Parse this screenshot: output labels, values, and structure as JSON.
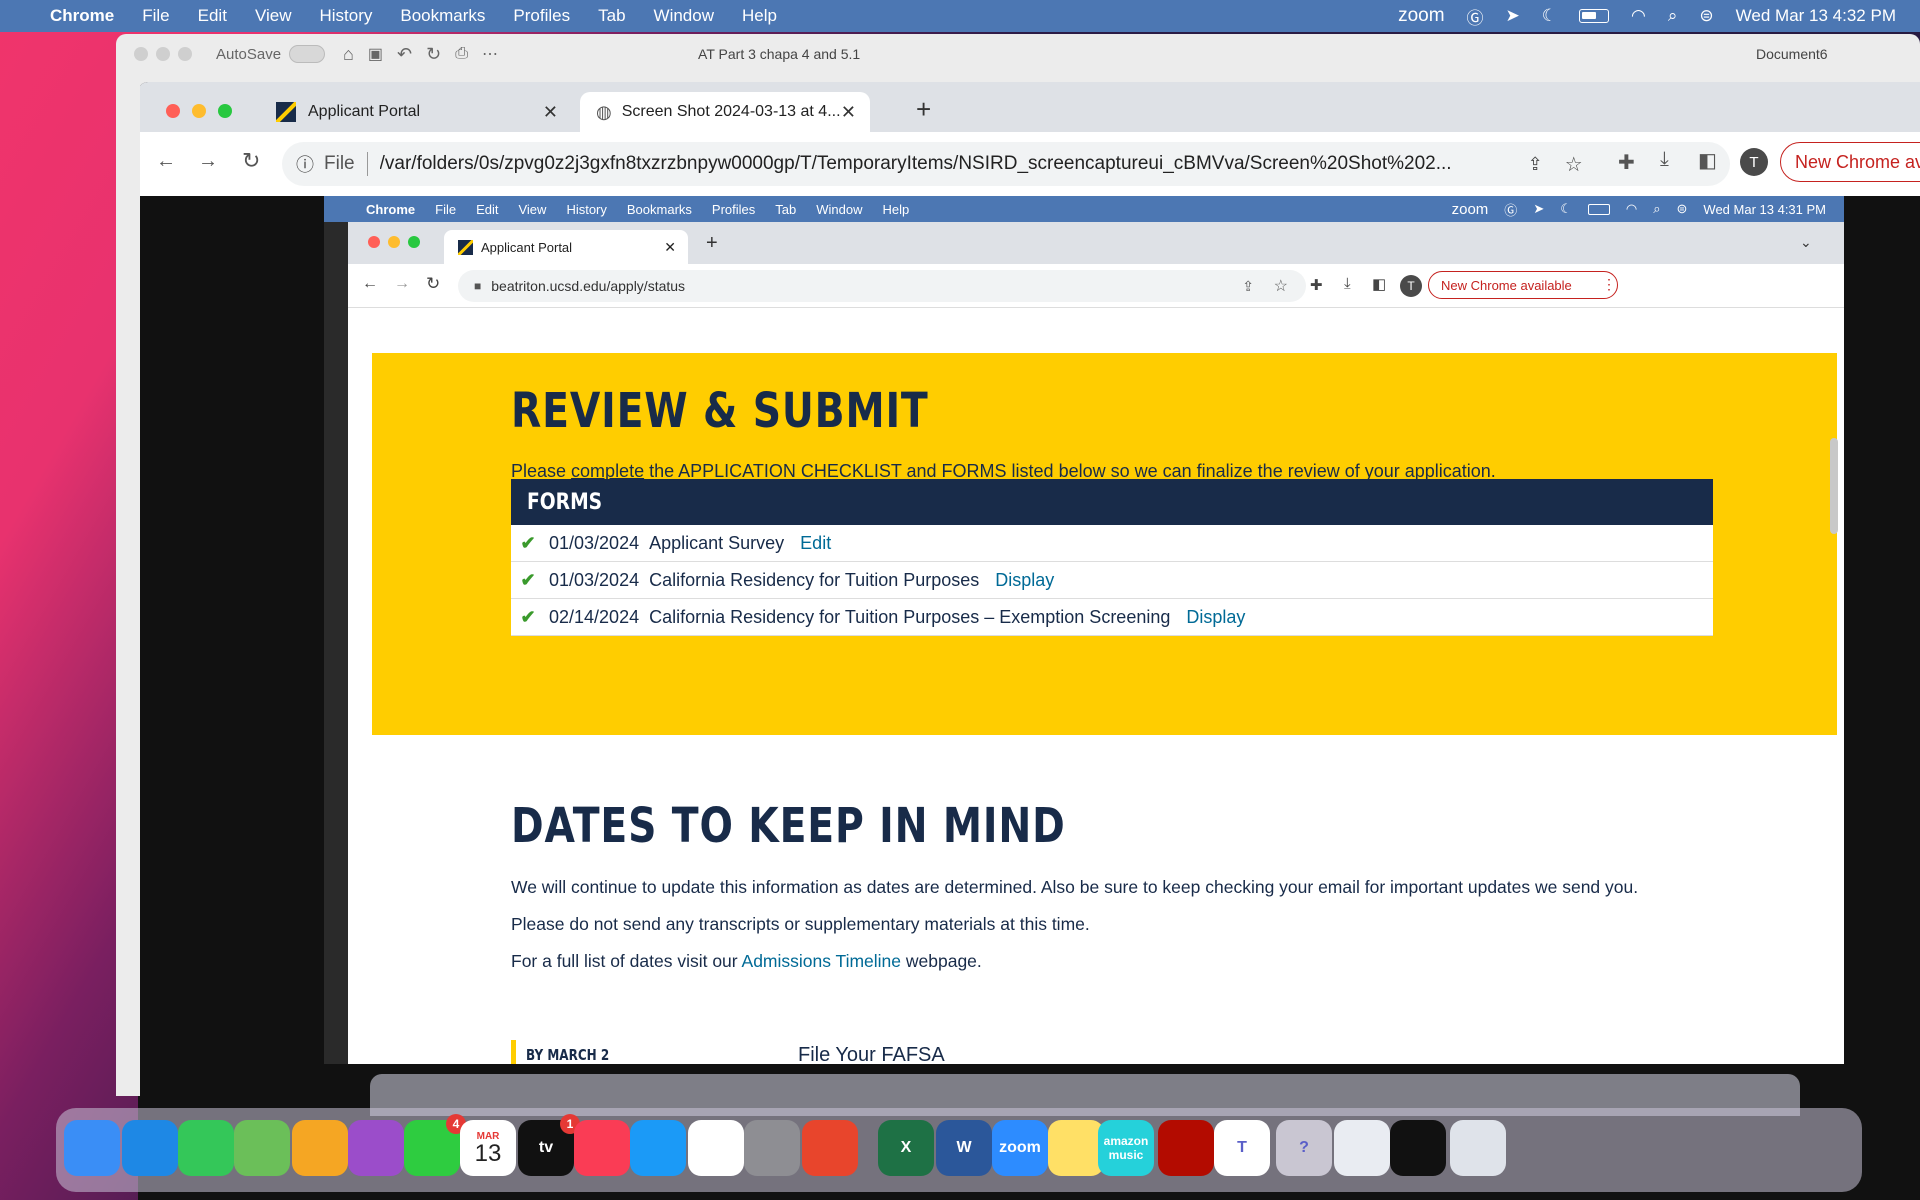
{
  "menubar": {
    "apple": "",
    "app": "Chrome",
    "items": [
      "File",
      "Edit",
      "View",
      "History",
      "Bookmarks",
      "Profiles",
      "Tab",
      "Window",
      "Help"
    ],
    "status": {
      "zoom": "zoom",
      "datetime": "Wed Mar 13  4:32 PM"
    }
  },
  "word_window": {
    "autosave": "AutoSave",
    "doc_title_partial": "AT Part 3 chapa 4 and 5.1",
    "doc_title_right": "Document6"
  },
  "chrome": {
    "tabs": [
      {
        "title": "Applicant Portal"
      },
      {
        "title": "Screen Shot 2024-03-13 at 4..."
      }
    ],
    "new_tab": "+",
    "address_scheme": "File",
    "address": "/var/folders/0s/zpvg0z2j3gxfn8txzrzbnpyw0000gp/T/TemporaryItems/NSIRD_screencaptureui_cBMVva/Screen%20Shot%202...",
    "profile": "T",
    "new_chrome": "New Chrome av"
  },
  "inner": {
    "menubar": {
      "app": "Chrome",
      "items": [
        "File",
        "Edit",
        "View",
        "History",
        "Bookmarks",
        "Profiles",
        "Tab",
        "Window",
        "Help"
      ],
      "status": {
        "zoom": "zoom",
        "datetime": "Wed Mar 13  4:31 PM"
      }
    },
    "tab_title": "Applicant Portal",
    "url": "beatriton.ucsd.edu/apply/status",
    "profile": "T",
    "new_chrome": "New Chrome available",
    "review": {
      "heading": "REVIEW & SUBMIT",
      "intro_pre": "Please ",
      "intro_link": "complete",
      "intro_post": " the APPLICATION CHECKLIST and FORMS listed below so we can finalize the review of your application.",
      "forms_header": "FORMS",
      "forms": [
        {
          "date": "01/03/2024",
          "name": "Applicant Survey",
          "action": "Edit"
        },
        {
          "date": "01/03/2024",
          "name": "California Residency for Tuition Purposes",
          "action": "Display"
        },
        {
          "date": "02/14/2024",
          "name": "California Residency for Tuition Purposes – Exemption Screening",
          "action": "Display"
        }
      ]
    },
    "dates": {
      "heading": "DATES TO KEEP IN MIND",
      "p1": "We will continue to update this information as dates are determined. Also be sure to keep checking your email for important updates we send you.",
      "p2": "Please do not send any transcripts or supplementary materials at this time.",
      "p3_pre": "For a full list of dates visit our ",
      "p3_link": "Admissions Timeline",
      "p3_post": " webpage.",
      "item_label": "BY MARCH 2",
      "item_title": "File Your FAFSA"
    }
  },
  "dock": {
    "items": [
      {
        "name": "Finder",
        "icon": "finder-icon",
        "color": "#3a8ef6"
      },
      {
        "name": "Safari",
        "icon": "safari-icon",
        "color": "#1e88e5"
      },
      {
        "name": "Messages",
        "icon": "messages-icon",
        "color": "#34c759"
      },
      {
        "name": "Maps",
        "icon": "maps-icon",
        "color": "#6bbf59"
      },
      {
        "name": "Photos",
        "icon": "photos-icon",
        "color": "#f5a623"
      },
      {
        "name": "Podcasts",
        "icon": "podcasts-icon",
        "color": "#9b4dca"
      },
      {
        "name": "FaceTime",
        "icon": "facetime-icon",
        "color": "#2ecc40",
        "badge": "4"
      },
      {
        "name": "Calendar",
        "icon": "calendar-icon",
        "color": "#ffffff",
        "month": "MAR",
        "day": "13"
      },
      {
        "name": "TV",
        "icon": "tv-icon",
        "color": "#111111",
        "label": "tv",
        "badge": "1"
      },
      {
        "name": "Music",
        "icon": "music-icon",
        "color": "#fa3c55"
      },
      {
        "name": "App Store",
        "icon": "app-store-icon",
        "color": "#1b9af7"
      },
      {
        "name": "Chrome",
        "icon": "chrome-icon",
        "color": "#ffffff"
      },
      {
        "name": "System Preferences",
        "icon": "system-preferences-icon",
        "color": "#8e8e93"
      },
      {
        "name": "Remote Desktop",
        "icon": "remote-desktop-icon",
        "color": "#e8452c"
      },
      {
        "name": "Excel",
        "icon": "excel-icon",
        "color": "#1e7145",
        "label": "X"
      },
      {
        "name": "Word",
        "icon": "word-icon",
        "color": "#2b579a",
        "label": "W"
      },
      {
        "name": "Zoom",
        "icon": "zoom-icon",
        "color": "#2d8cff",
        "label": "zoom"
      },
      {
        "name": "Notes",
        "icon": "notes-icon",
        "color": "#ffe066"
      },
      {
        "name": "Amazon Music",
        "icon": "amazon-music-icon",
        "color": "#25d1da",
        "label": "amazon music"
      },
      {
        "name": "Acrobat",
        "icon": "acrobat-icon",
        "color": "#b30b00"
      },
      {
        "name": "Teams",
        "icon": "teams-icon",
        "color": "#ffffff",
        "label": "T"
      },
      {
        "name": "Help",
        "icon": "help-icon",
        "color": "#c9c6d2",
        "label": "?"
      },
      {
        "name": "Preview",
        "icon": "preview-icon",
        "color": "#e9ecf2"
      },
      {
        "name": "Screenshot",
        "icon": "screenshot-icon",
        "color": "#111111"
      },
      {
        "name": "Trash",
        "icon": "trash-icon",
        "color": "#dfe3ea"
      }
    ]
  }
}
